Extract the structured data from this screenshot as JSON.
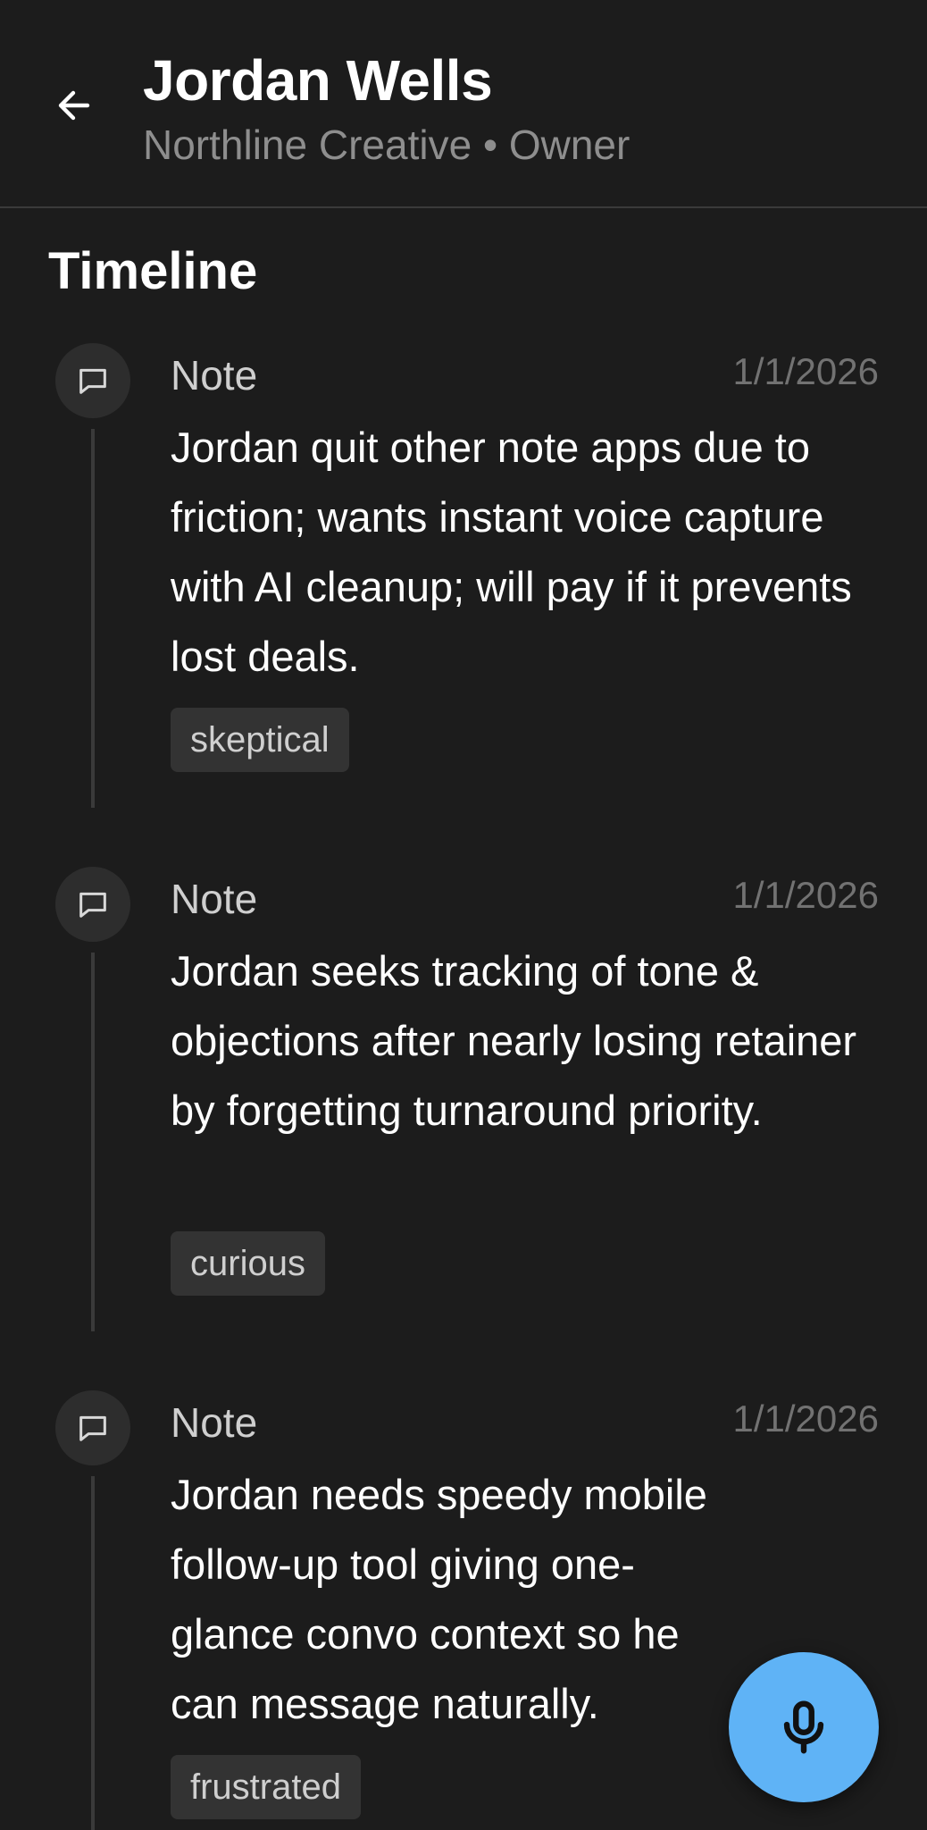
{
  "header": {
    "back_icon": "arrow-left-icon",
    "name": "Jordan Wells",
    "subtitle": "Northline Creative • Owner"
  },
  "timeline": {
    "title": "Timeline",
    "entries": [
      {
        "icon": "comment-icon",
        "type": "Note",
        "date": "1/1/2026",
        "text": "Jordan quit other note apps due to friction; wants instant voice capture with AI cleanup; will pay if it prevents lost deals.",
        "tag": "skeptical"
      },
      {
        "icon": "comment-icon",
        "type": "Note",
        "date": "1/1/2026",
        "text": "Jordan seeks tracking of tone & objections after nearly losing retainer by forgetting turnaround priority.",
        "tag": "curious"
      },
      {
        "icon": "comment-icon",
        "type": "Note",
        "date": "1/1/2026",
        "text": "Jordan needs speedy mobile follow-up tool giving one-glance convo context so he can message naturally.",
        "tag": "frustrated"
      }
    ]
  },
  "fab": {
    "icon": "microphone-icon",
    "color": "#5fb3f6"
  }
}
